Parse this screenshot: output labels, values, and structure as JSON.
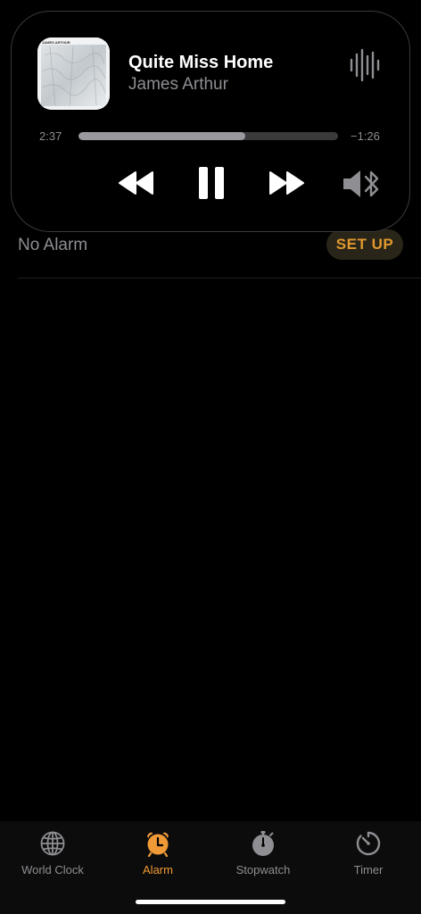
{
  "alarm": {
    "no_alarm_label": "No Alarm",
    "setup_label": "SET UP"
  },
  "now_playing": {
    "artwork_text": "JAMES ARTHUR",
    "title": "Quite Miss Home",
    "artist": "James Arthur",
    "elapsed": "2:37",
    "remaining": "−1:26",
    "progress": 0.644,
    "icons": [
      "waveform-icon",
      "rewind-icon",
      "pause-icon",
      "fast-forward-icon",
      "speaker-bluetooth-icon"
    ]
  },
  "tabs": [
    {
      "label": "World Clock",
      "icon": "globe-icon",
      "active": false
    },
    {
      "label": "Alarm",
      "icon": "alarm-clock-icon",
      "active": true
    },
    {
      "label": "Stopwatch",
      "icon": "stopwatch-icon",
      "active": false
    },
    {
      "label": "Timer",
      "icon": "timer-icon",
      "active": false
    }
  ],
  "colors": {
    "accent": "#f09a37",
    "setup_bg": "#2a2519",
    "secondary_text": "#8e8e93"
  }
}
